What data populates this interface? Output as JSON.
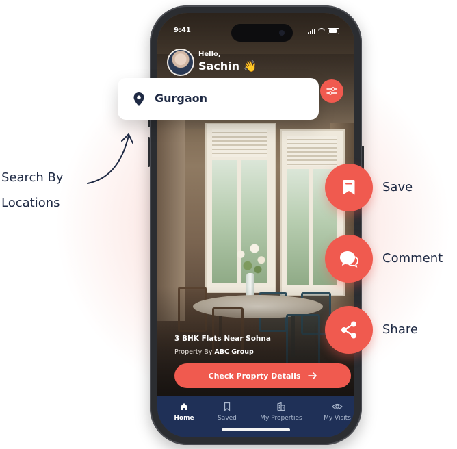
{
  "status_bar": {
    "time": "9:41"
  },
  "header": {
    "greeting": "Hello,",
    "user_name": "Sachin 👋"
  },
  "search": {
    "location_value": "Gurgaon"
  },
  "annotation": {
    "line1": "Search By",
    "line2": "Locations"
  },
  "property": {
    "title": "3 BHK Flats Near Sohna",
    "by_prefix": "Property By ",
    "by_company": "ABC Group"
  },
  "cta": {
    "label": "Check Proprty Details"
  },
  "bottom_nav": {
    "items": [
      {
        "label": "Home",
        "icon": "home-icon",
        "active": true
      },
      {
        "label": "Saved",
        "icon": "bookmark-icon",
        "active": false
      },
      {
        "label": "My Properties",
        "icon": "building-icon",
        "active": false
      },
      {
        "label": "My Visits",
        "icon": "eye-icon",
        "active": false
      }
    ]
  },
  "actions": {
    "save": {
      "label": "Save",
      "icon": "bookmark-icon"
    },
    "comment": {
      "label": "Comment",
      "icon": "chat-bubble-icon"
    },
    "share": {
      "label": "Share",
      "icon": "share-icon"
    }
  },
  "colors": {
    "accent": "#f05a4f",
    "navy": "#1f3057",
    "text_dark": "#1f2a44"
  }
}
